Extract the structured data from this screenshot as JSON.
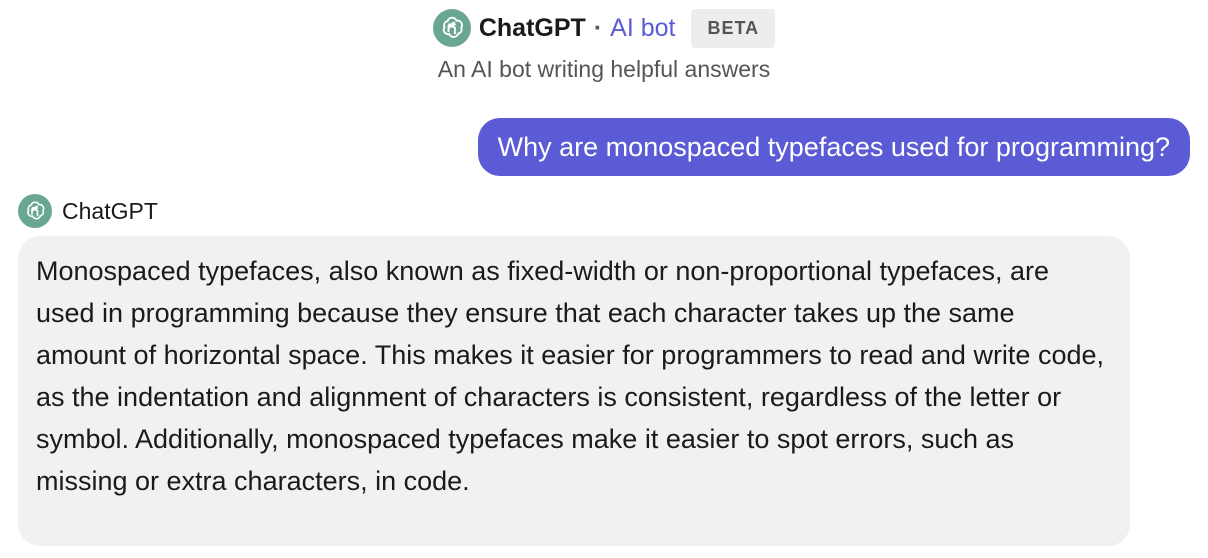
{
  "header": {
    "bot_name": "ChatGPT",
    "separator": "·",
    "bot_type": "AI bot",
    "badge": "BETA",
    "subtitle": "An AI bot writing helpful answers"
  },
  "messages": {
    "user": {
      "text": "Why are monospaced typefaces used for programming?"
    },
    "bot": {
      "sender": "ChatGPT",
      "text": "Monospaced typefaces, also known as fixed-width or non-proportional typefaces, are used in programming because they ensure that each character takes up the same amount of horizontal space. This makes it easier for programmers to read and write code, as the indentation and alignment of characters is consistent, regardless of the letter or symbol. Additionally, monospaced typefaces make it easier to spot errors, such as missing or extra characters, in code."
    }
  },
  "icons": {
    "bot_avatar": "openai-logo-icon"
  },
  "colors": {
    "accent": "#5b5bd6",
    "avatar_bg": "#6aa790",
    "bot_bubble_bg": "#f1f1f1",
    "badge_bg": "#ededed"
  }
}
